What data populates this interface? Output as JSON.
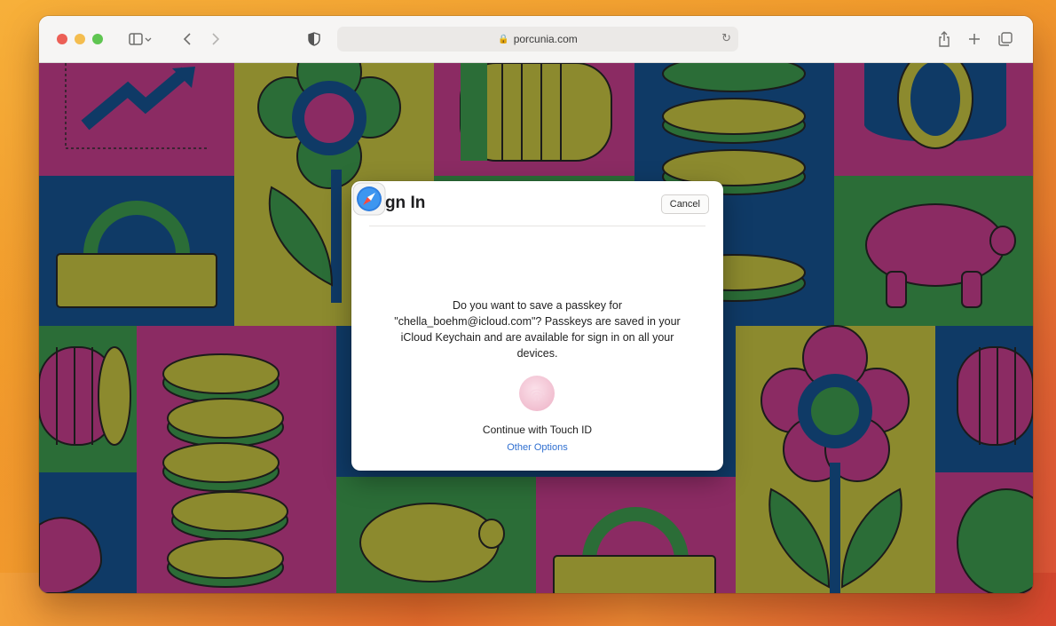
{
  "browser": {
    "url": "porcunia.com",
    "icons": {
      "sidebar": "sidebar-icon",
      "back": "chevron-left-icon",
      "forward": "chevron-right-icon",
      "privacy": "shield-icon",
      "reload": "reload-icon",
      "share": "share-icon",
      "new_tab": "plus-icon",
      "tabs": "tabs-overview-icon"
    }
  },
  "dialog": {
    "title": "Sign In",
    "cancel_label": "Cancel",
    "message": "Do you want to save a passkey for \"chella_boehm@icloud.com\"? Passkeys are saved in your iCloud Keychain and are available for sign in on all your devices.",
    "touch_id_label": "Continue with Touch ID",
    "other_options_label": "Other Options"
  },
  "colors": {
    "green": "#2b6d37",
    "olive": "#8c8a2e",
    "magenta": "#8b2b63",
    "navy": "#0f3a66",
    "link": "#2f6fd0"
  }
}
